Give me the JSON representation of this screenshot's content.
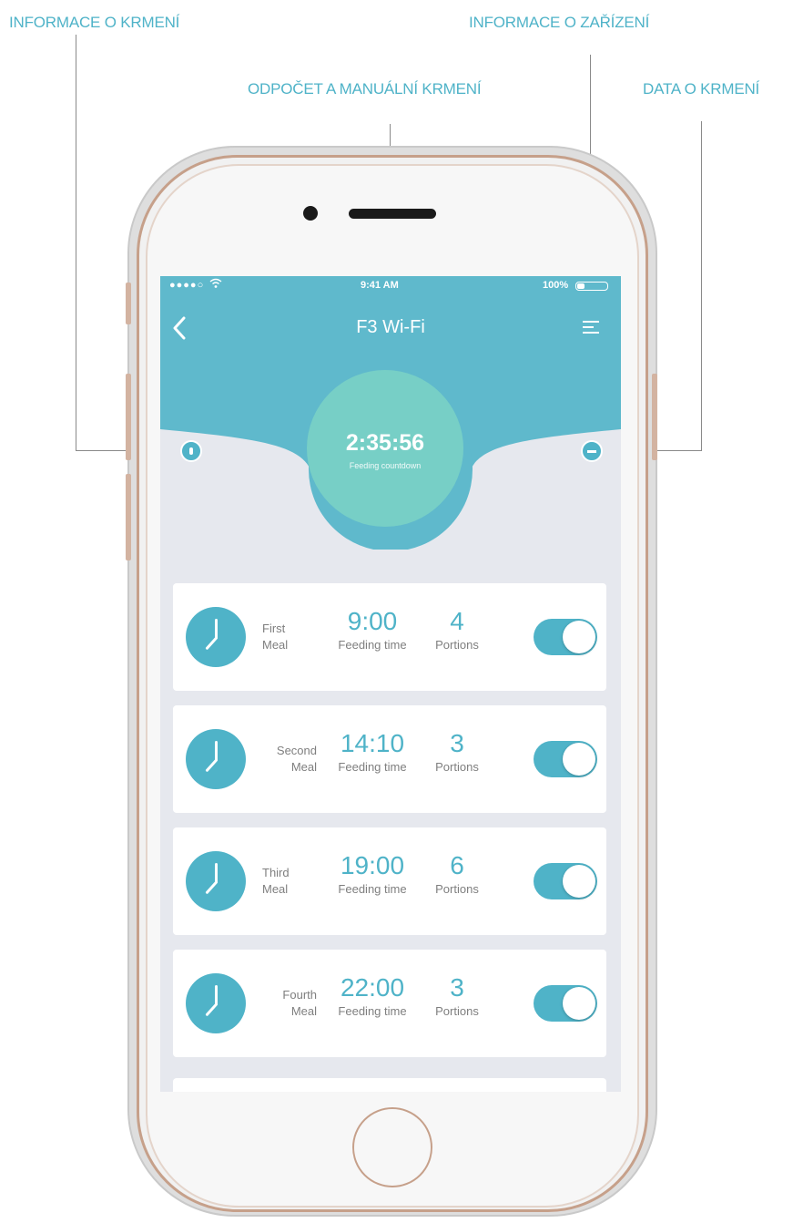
{
  "callouts": {
    "feeding_info": "INFORMACE O KRMENÍ",
    "device_info": "INFORMACE O ZAŘÍZENÍ",
    "countdown_manual": "ODPOČET A MANUÁLNÍ KRMENÍ",
    "feeding_data": "DATA O KRMENÍ"
  },
  "status_bar": {
    "signal": "●●●●○",
    "time": "9:41 AM",
    "battery": "100%"
  },
  "nav": {
    "title": "F3 Wi-Fi"
  },
  "countdown": {
    "time": "2:35:56",
    "label": "Feeding countdown"
  },
  "colors": {
    "accent": "#4fb3c8",
    "countdown_circle": "#77cfc6",
    "screen_bg": "#e6e8ee"
  },
  "meals": [
    {
      "name_line1": "First",
      "name_line2": "Meal",
      "time": "9:00",
      "time_label": "Feeding time",
      "portions": "4",
      "portions_label": "Portions",
      "enabled": true
    },
    {
      "name_line1": "Second",
      "name_line2": "Meal",
      "time": "14:10",
      "time_label": "Feeding time",
      "portions": "3",
      "portions_label": "Portions",
      "enabled": true
    },
    {
      "name_line1": "Third",
      "name_line2": "Meal",
      "time": "19:00",
      "time_label": "Feeding time",
      "portions": "6",
      "portions_label": "Portions",
      "enabled": true
    },
    {
      "name_line1": "Fourth",
      "name_line2": "Meal",
      "time": "22:00",
      "time_label": "Feeding time",
      "portions": "3",
      "portions_label": "Portions",
      "enabled": true
    }
  ]
}
